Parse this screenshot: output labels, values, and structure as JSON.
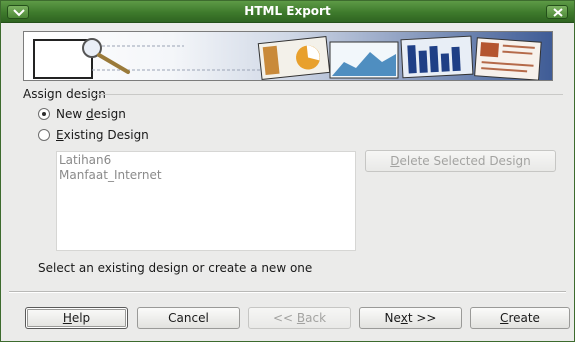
{
  "window": {
    "title": "HTML Export",
    "accent_color": "#3e7a2c",
    "menu_icon": "chevron-down-icon",
    "close_icon": "close-icon"
  },
  "banner": {
    "icons": [
      "magnifier-icon",
      "presentation-pie-chart-icon",
      "presentation-area-chart-icon",
      "presentation-bar-chart-icon",
      "presentation-text-icon"
    ]
  },
  "assign_design": {
    "label": "Assign design",
    "options": [
      {
        "prefix": "New ",
        "mnemonic": "d",
        "suffix": "esign",
        "selected": true
      },
      {
        "prefix": "",
        "mnemonic": "E",
        "suffix": "xisting Design",
        "selected": false
      }
    ],
    "designs": [
      "Latihan6",
      "Manfaat_Internet"
    ],
    "delete_button": {
      "prefix": "",
      "mnemonic": "D",
      "suffix": "elete Selected Design",
      "enabled": false
    },
    "hint": "Select an existing design or create a new one"
  },
  "footer": {
    "help": {
      "prefix": "",
      "mnemonic": "H",
      "suffix": "elp"
    },
    "cancel": {
      "label": "Cancel"
    },
    "back": {
      "prefix": "<< ",
      "mnemonic": "B",
      "suffix": "ack",
      "enabled": false
    },
    "next": {
      "prefix": "Ne",
      "mnemonic": "x",
      "suffix": "t >>"
    },
    "create": {
      "prefix": "",
      "mnemonic": "C",
      "suffix": "reate"
    }
  }
}
